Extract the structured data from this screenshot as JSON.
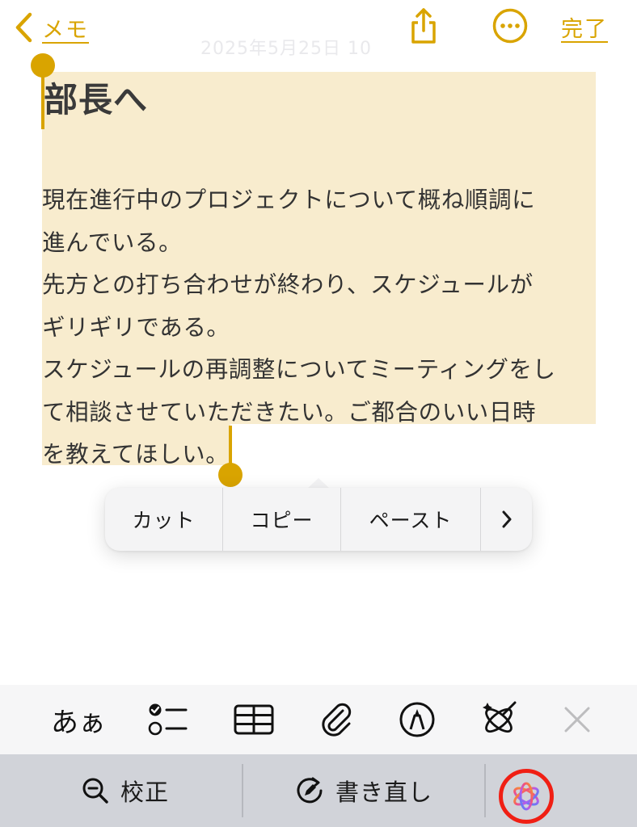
{
  "nav": {
    "back_label": "メモ",
    "done_label": "完了",
    "date_header": "2025年5月25日 10"
  },
  "note": {
    "title": "部長へ",
    "lines": [
      "現在進行中のプロジェクトについて概ね順調に",
      "進んでいる。",
      "先方との打ち合わせが終わり、スケジュールが",
      "ギリギリである。",
      "スケジュールの再調整についてミーティングをし",
      "て相談させていただきたい。ご都合のいい日時",
      "を教えてほしい。"
    ]
  },
  "context_menu": {
    "cut": "カット",
    "copy": "コピー",
    "paste": "ペースト",
    "more": "›"
  },
  "format_toolbar": {
    "text_style_label": "あぁ",
    "icons": [
      "checklist-icon",
      "table-icon",
      "paperclip-icon",
      "markup-pen-icon",
      "writing-tools-icon",
      "close-icon"
    ]
  },
  "keyboard_bar": {
    "proofread_label": "校正",
    "rewrite_label": "書き直し",
    "apple_intelligence_icon": "apple-intelligence-icon"
  },
  "colors": {
    "accent": "#d9a400",
    "selection": "#f8ecce",
    "highlight_ring": "#f01f14"
  }
}
